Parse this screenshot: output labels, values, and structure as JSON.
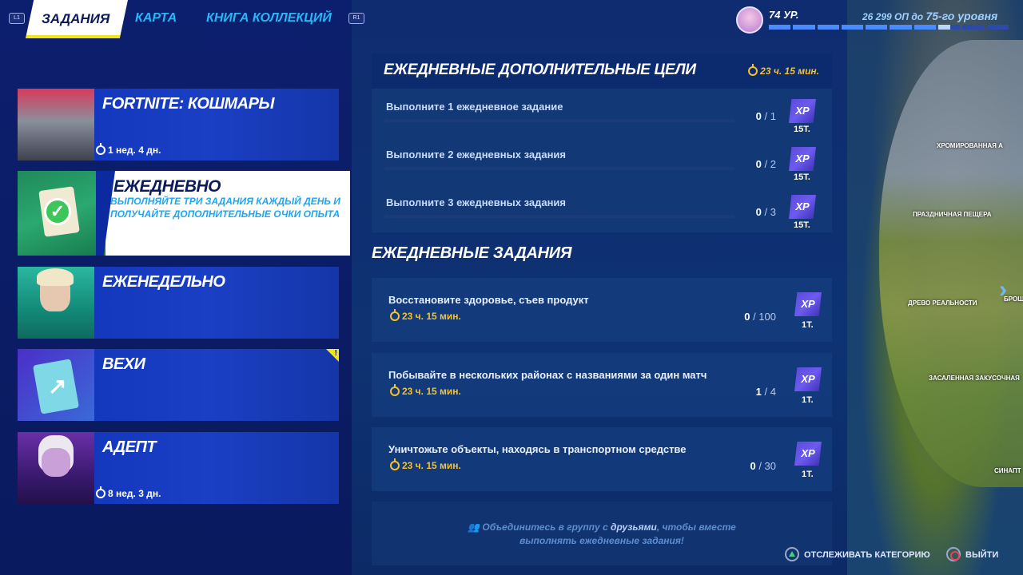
{
  "topbar": {
    "l1": "L1",
    "r1": "R1",
    "tabs": [
      "ЗАДАНИЯ",
      "КАРТА",
      "КНИГА КОЛЛЕКЦИЙ"
    ],
    "level": "74 УР.",
    "xp_points": "26 299 ОП",
    "xp_to": "до",
    "xp_target": "75-го уровня"
  },
  "sidebar": {
    "items": [
      {
        "title": "FORTNITE: КОШМАРЫ",
        "timer": "1 нед. 4 дн."
      },
      {
        "title": "ЕЖЕДНЕВНО",
        "desc": "ВЫПОЛНЯЙТЕ ТРИ ЗАДАНИЯ КАЖДЫЙ ДЕНЬ И ПОЛУЧАЙТЕ ДОПОЛНИТЕЛЬНЫЕ ОЧКИ ОПЫТА"
      },
      {
        "title": "ЕЖЕНЕДЕЛЬНО"
      },
      {
        "title": "ВЕХИ",
        "badge": "!"
      },
      {
        "title": "АДЕПТ",
        "timer": "8 нед. 3 дн."
      }
    ]
  },
  "bonus": {
    "title": "ЕЖЕДНЕВНЫЕ ДОПОЛНИТЕЛЬНЫЕ ЦЕЛИ",
    "timer": "23 ч. 15 мин.",
    "rows": [
      {
        "label": "Выполните 1 ежедневное задание",
        "progress": "0",
        "total": "/ 1",
        "xp": "XP",
        "reward": "15Т."
      },
      {
        "label": "Выполните 2 ежедневных задания",
        "progress": "0",
        "total": "/ 2",
        "xp": "XP",
        "reward": "15Т."
      },
      {
        "label": "Выполните 3 ежедневных задания",
        "progress": "0",
        "total": "/ 3",
        "xp": "XP",
        "reward": "15Т."
      }
    ]
  },
  "daily": {
    "title": "ЕЖЕДНЕВНЫЕ ЗАДАНИЯ",
    "quests": [
      {
        "label": "Восстановите здоровье, съев продукт",
        "timer": "23 ч. 15 мин.",
        "progress": "0",
        "total": "/ 100",
        "xp": "XP",
        "reward": "1Т."
      },
      {
        "label": "Побывайте в нескольких районах с названиями за один матч",
        "timer": "23 ч. 15 мин.",
        "progress": "1",
        "total": "/ 4",
        "xp": "XP",
        "reward": "1Т."
      },
      {
        "label": "Уничтожьте объекты, находясь в транспортном средстве",
        "timer": "23 ч. 15 мин.",
        "progress": "0",
        "total": "/ 30",
        "xp": "XP",
        "reward": "1Т."
      }
    ]
  },
  "party": {
    "line1_a": "Объединитесь в группу с",
    "line1_b": "друзьями",
    "line1_c": ", чтобы вместе",
    "line2": "выполнять ежедневные задания!"
  },
  "map": {
    "labels": [
      "ХРОМИРОВАННАЯ А",
      "ПРАЗДНИЧНАЯ ПЕЩЕРА",
      "ДРЕВО РЕАЛЬНОСТИ",
      "БРОШ",
      "ЗАСАЛЕННАЯ ЗАКУСОЧНАЯ",
      "СИНАПТ"
    ]
  },
  "footer": {
    "track": "ОТСЛЕЖИВАТЬ КАТЕГОРИЮ",
    "exit": "ВЫЙТИ"
  }
}
